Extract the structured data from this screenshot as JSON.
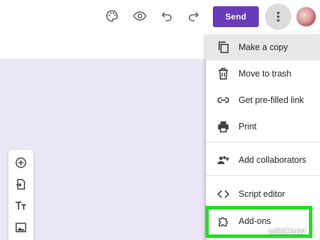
{
  "header": {
    "send_label": "Send",
    "icons": [
      "palette-icon",
      "eye-icon",
      "undo-icon",
      "redo-icon",
      "more-vert-icon"
    ]
  },
  "side_toolbar": {
    "tools": [
      "add-question-icon",
      "import-questions-icon",
      "add-title-icon",
      "add-image-icon"
    ]
  },
  "menu": {
    "items": [
      {
        "label": "Make a copy",
        "icon": "copy-icon"
      },
      {
        "label": "Move to trash",
        "icon": "trash-icon"
      },
      {
        "label": "Get pre-filled link",
        "icon": "link-icon"
      },
      {
        "label": "Print",
        "icon": "printer-icon"
      },
      {
        "label": "Add collaborators",
        "icon": "add-collaborators-icon"
      },
      {
        "label": "Script editor",
        "icon": "code-icon"
      },
      {
        "label": "Add-ons",
        "icon": "puzzle-icon"
      }
    ]
  },
  "watermark": {
    "part1": "wiki",
    "part2": "How"
  },
  "colors": {
    "accent": "#673ab7",
    "canvas": "#ebe6f5",
    "highlight": "#1ee01e",
    "menu_hover": "#e8e8e8"
  }
}
